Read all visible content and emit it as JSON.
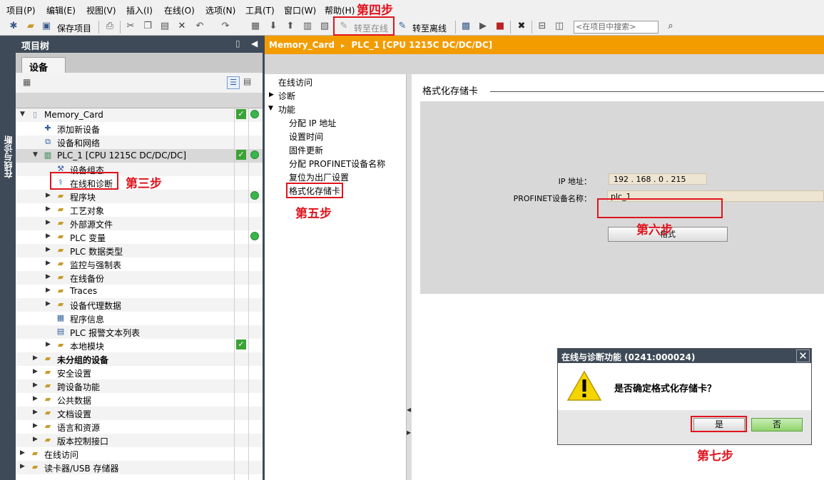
{
  "menu": [
    "项目(P)",
    "编辑(E)",
    "视图(V)",
    "插入(I)",
    "在线(O)",
    "选项(N)",
    "工具(T)",
    "窗口(W)",
    "帮助(H)"
  ],
  "toolbar": {
    "save_project": "保存项目",
    "go_online": "转至在线",
    "go_offline": "转至离线",
    "search_placeholder": "<在项目中搜索>"
  },
  "left_vertical_tab": "在线与诊断",
  "project_tree": {
    "title": "项目树",
    "tab": "设备",
    "items": [
      {
        "label": "Memory_Card",
        "icon": "document-icon",
        "check": true,
        "status": "ok"
      },
      {
        "label": "添加新设备",
        "icon": "add-device-icon"
      },
      {
        "label": "设备和网络",
        "icon": "network-icon"
      },
      {
        "label": "PLC_1 [CPU 1215C DC/DC/DC]",
        "icon": "plc-icon",
        "check": true,
        "status": "ok"
      },
      {
        "label": "设备组态",
        "icon": "device-config-icon"
      },
      {
        "label": "在线和诊断",
        "icon": "diagnostics-icon"
      },
      {
        "label": "程序块",
        "icon": "folder-icon",
        "status": "ok"
      },
      {
        "label": "工艺对象",
        "icon": "folder-icon"
      },
      {
        "label": "外部源文件",
        "icon": "folder-icon"
      },
      {
        "label": "PLC 变量",
        "icon": "folder-icon",
        "status": "ok"
      },
      {
        "label": "PLC 数据类型",
        "icon": "folder-icon"
      },
      {
        "label": "监控与强制表",
        "icon": "folder-icon"
      },
      {
        "label": "在线备份",
        "icon": "folder-icon"
      },
      {
        "label": "Traces",
        "icon": "folder-icon"
      },
      {
        "label": "设备代理数据",
        "icon": "folder-icon"
      },
      {
        "label": "程序信息",
        "icon": "program-info-icon"
      },
      {
        "label": "PLC 报警文本列表",
        "icon": "text-list-icon"
      },
      {
        "label": "本地模块",
        "icon": "folder-icon",
        "check": true
      },
      {
        "label": "未分组的设备",
        "icon": "folder-icon"
      },
      {
        "label": "安全设置",
        "icon": "folder-icon"
      },
      {
        "label": "跨设备功能",
        "icon": "folder-icon"
      },
      {
        "label": "公共数据",
        "icon": "folder-icon"
      },
      {
        "label": "文档设置",
        "icon": "folder-icon"
      },
      {
        "label": "语言和资源",
        "icon": "folder-icon"
      },
      {
        "label": "版本控制接口",
        "icon": "folder-icon"
      },
      {
        "label": "在线访问",
        "icon": "folder-icon"
      },
      {
        "label": "读卡器/USB 存储器",
        "icon": "folder-icon"
      }
    ]
  },
  "breadcrumb": {
    "project": "Memory_Card",
    "separator": "▸",
    "device": "PLC_1 [CPU 1215C DC/DC/DC]"
  },
  "function_nav": {
    "items": [
      "在线访问",
      "诊断",
      "功能",
      "分配 IP 地址",
      "设置时间",
      "固件更新",
      "分配 PROFINET设备名称",
      "复位为出厂设置",
      "格式化存储卡"
    ]
  },
  "content": {
    "section_title": "格式化存储卡",
    "ip_label": "IP 地址：",
    "ip_value": "192 . 168 . 0     . 215",
    "profinet_label": "PROFINET设备名称：",
    "profinet_value": "plc_1",
    "format_button": "格式"
  },
  "dialog": {
    "title": "在线与诊断功能 (0241:000024)",
    "message": "是否确定格式化存储卡？",
    "yes": "是",
    "no": "否"
  },
  "annotations": {
    "step3": "第三步",
    "step4": "第四步",
    "step5": "第五步",
    "step6": "第六步",
    "step7": "第七步"
  },
  "colors": {
    "accent_orange": "#f39c00",
    "header_dark": "#3e4a57",
    "status_green": "#39b54a",
    "annotation_red": "#e0141e"
  }
}
